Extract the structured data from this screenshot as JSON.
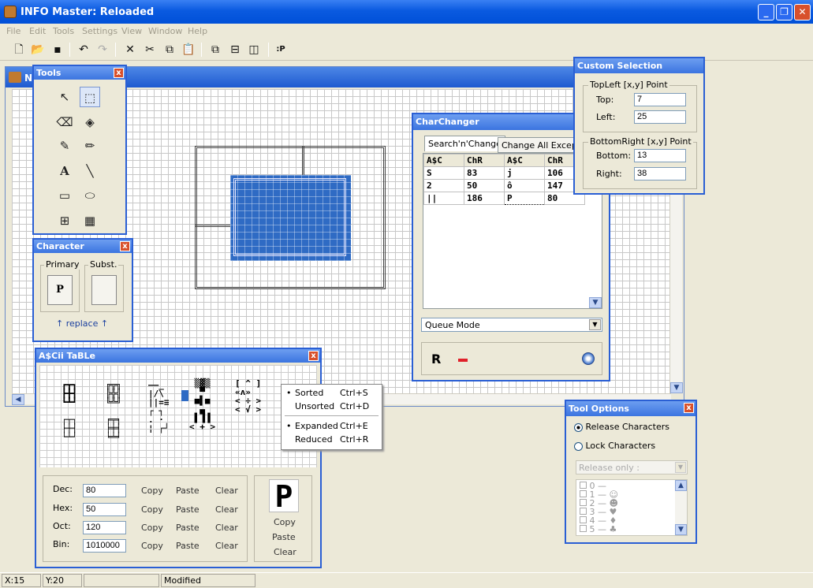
{
  "window": {
    "title": "INFO Master: Reloaded"
  },
  "menu": [
    "File",
    "Edit",
    "Tools",
    "Settings",
    "View",
    "Window",
    "Help"
  ],
  "toolbar": {
    "p_label": ":P"
  },
  "document": {
    "title_prefix": "N"
  },
  "tools_palette": {
    "title": "Tools",
    "close": "x"
  },
  "character_palette": {
    "title": "Character",
    "primary_label": "Primary",
    "subst_label": "Subst.",
    "primary_char": "P",
    "replace_label": "replace"
  },
  "ascii_table": {
    "title": "A$Cii TaBLe",
    "rows": [
      {
        "label": "Dec:",
        "value": "80"
      },
      {
        "label": "Hex:",
        "value": "50"
      },
      {
        "label": "Oct:",
        "value": "120"
      },
      {
        "label": "Bin:",
        "value": "1010000"
      }
    ],
    "copy": "Copy",
    "paste": "Paste",
    "clear": "Clear",
    "preview_char": "P"
  },
  "context_menu": {
    "items": [
      {
        "label": "Sorted",
        "shortcut": "Ctrl+S",
        "checked": true
      },
      {
        "label": "Unsorted",
        "shortcut": "Ctrl+D",
        "checked": false
      },
      {
        "label": "Expanded",
        "shortcut": "Ctrl+E",
        "checked": true
      },
      {
        "label": "Reduced",
        "shortcut": "Ctrl+R",
        "checked": false
      }
    ]
  },
  "charchanger": {
    "title": "CharChanger",
    "tabs": [
      "Search'n'Change",
      "Change All Except"
    ],
    "headers": [
      "A$C",
      "ChR",
      "A$C",
      "ChR"
    ],
    "rows": [
      [
        "S",
        "83",
        "j",
        "106"
      ],
      [
        "2",
        "50",
        "ô",
        "147"
      ],
      [
        "||",
        "186",
        "P",
        "80"
      ]
    ],
    "mode": "Queue Mode",
    "r_label": "R"
  },
  "custom_selection": {
    "title": "Custom Selection",
    "topleft_label": "TopLeft [x,y] Point",
    "top_label": "Top:",
    "top_value": "7",
    "left_label": "Left:",
    "left_value": "25",
    "bottomright_label": "BottomRight [x,y] Point",
    "bottom_label": "Bottom:",
    "bottom_value": "13",
    "right_label": "Right:",
    "right_value": "38"
  },
  "tool_options": {
    "title": "Tool Options",
    "release_label": "Release Characters",
    "lock_label": "Lock Characters",
    "select_placeholder": "Release only :",
    "list": [
      "0  —",
      "1  —  ☺",
      "2  —  ☻",
      "3  —  ♥",
      "4  —  ♦",
      "5  —  ♣"
    ]
  },
  "status": {
    "x": "X:15",
    "y": "Y:20",
    "state": "Modified"
  }
}
